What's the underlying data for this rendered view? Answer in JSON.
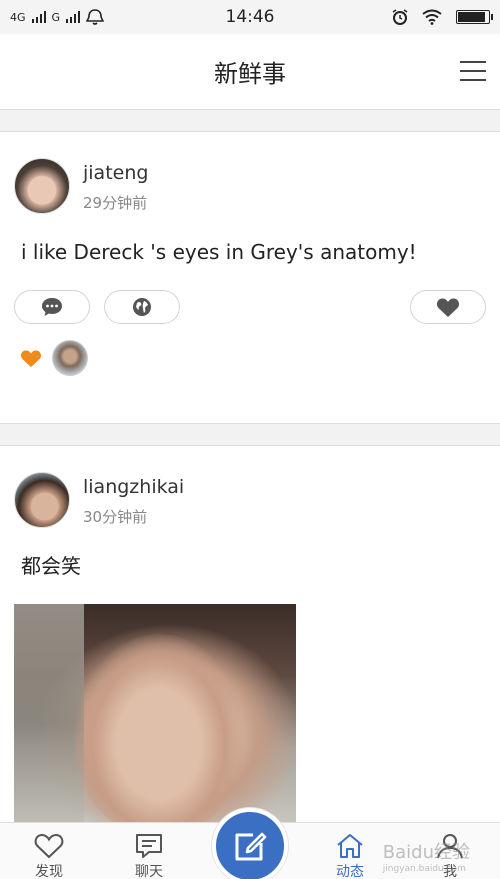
{
  "status_bar": {
    "network_1": "4G",
    "network_2": "G",
    "time": "14:46",
    "battery_level": 0.9
  },
  "header": {
    "title": "新鲜事"
  },
  "posts": [
    {
      "username": "jiateng",
      "time_ago": "29分钟前",
      "text": "i like Dereck 's eyes in Grey's anatomy!"
    },
    {
      "username": "liangzhikai",
      "time_ago": "30分钟前",
      "text": "都会笑"
    }
  ],
  "tabs": [
    {
      "label": "发现",
      "icon": "heart-icon"
    },
    {
      "label": "聊天",
      "icon": "chat-bubble-icon"
    },
    {
      "label": "动态",
      "icon": "home-icon",
      "active": true
    },
    {
      "label": "我",
      "icon": "person-icon"
    }
  ],
  "watermark": {
    "text": "Baidu经验",
    "subtext": "jingyan.baidu.com"
  },
  "colors": {
    "accent": "#3a6fc4",
    "like_orange": "#f08a1c"
  }
}
